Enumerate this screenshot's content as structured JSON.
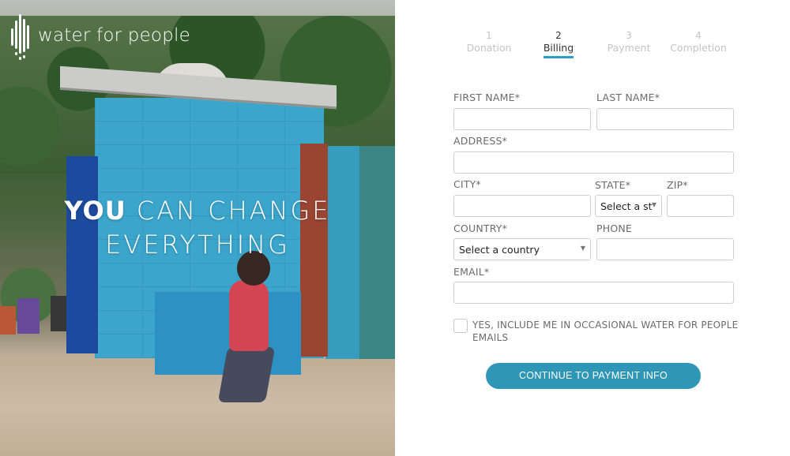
{
  "brand": {
    "logo_text": "water for people",
    "accent_color": "#2e97b8"
  },
  "hero": {
    "tagline_bold": "YOU",
    "tagline_line1_rest": " CAN CHANGE",
    "tagline_line2": "EVERYTHING"
  },
  "steps": [
    {
      "number": "1",
      "label": "Donation",
      "active": false
    },
    {
      "number": "2",
      "label": "Billing",
      "active": true
    },
    {
      "number": "3",
      "label": "Payment",
      "active": false
    },
    {
      "number": "4",
      "label": "Completion",
      "active": false
    }
  ],
  "form": {
    "first_name": {
      "label": "FIRST NAME*",
      "value": ""
    },
    "last_name": {
      "label": "LAST NAME*",
      "value": ""
    },
    "address": {
      "label": "ADDRESS*",
      "value": ""
    },
    "city": {
      "label": "CITY*",
      "value": ""
    },
    "state": {
      "label": "STATE*",
      "selected": "Select a st"
    },
    "zip": {
      "label": "ZIP*",
      "value": ""
    },
    "country": {
      "label": "COUNTRY*",
      "selected": "Select a country"
    },
    "phone": {
      "label": "PHONE",
      "value": ""
    },
    "email": {
      "label": "EMAIL*",
      "value": ""
    },
    "opt_in": {
      "label": "YES, INCLUDE ME IN OCCASIONAL WATER FOR PEOPLE EMAILS",
      "checked": false
    },
    "submit_label": "CONTINUE TO PAYMENT INFO"
  }
}
